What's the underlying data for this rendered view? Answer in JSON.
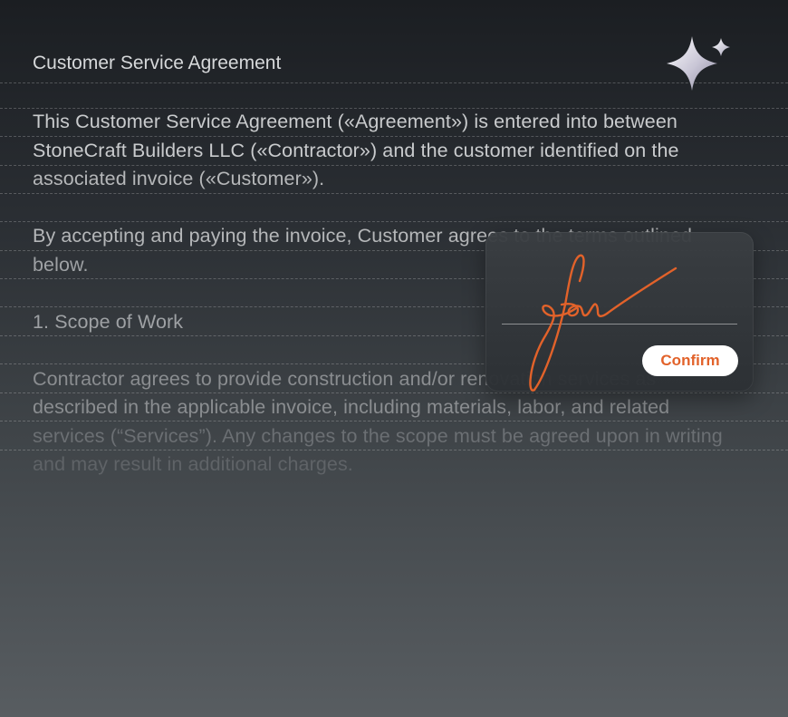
{
  "document": {
    "title": "Customer Service Agreement",
    "lines": [
      "This Customer Service Agreement («Agreement») is entered into between",
      "StoneCraft Builders LLC («Contractor») and the customer identified on the",
      "associated invoice («Customer»).",
      "By accepting and paying the invoice, Customer agrees to the terms outlined",
      "below.",
      "1. Scope of Work",
      "Contractor agrees to provide construction and/or renovation services as",
      "described in the applicable invoice, including materials, labor, and related",
      "services (“Services”). Any changes to the scope must be agreed upon in writing",
      "and may result in additional charges."
    ]
  },
  "signature_panel": {
    "confirm_label": "Confirm",
    "stroke_color": "#e2622a"
  },
  "icons": {
    "top_right": "sparkle-icon"
  }
}
